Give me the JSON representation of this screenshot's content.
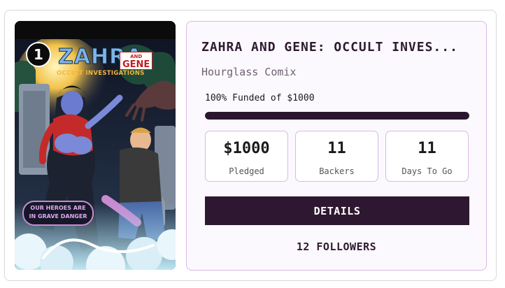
{
  "cover": {
    "issue_number": "1",
    "logo_title": "ZAHRA",
    "logo_and": "AND",
    "logo_gene": "GENE",
    "logo_subtitle": "OCCULT INVESTIGATIONS",
    "tagline_line1": "OUR HEROES ARE",
    "tagline_line2": "IN GRAVE DANGER"
  },
  "campaign": {
    "title": "ZAHRA AND GENE: OCCULT INVES...",
    "publisher": "Hourglass Comix",
    "funded_text": "100% Funded of $1000",
    "progress_fraction": 1.0
  },
  "stats": [
    {
      "value": "$1000",
      "label": "Pledged"
    },
    {
      "value": "11",
      "label": "Backers"
    },
    {
      "value": "11",
      "label": "Days To Go"
    }
  ],
  "details_label": "DETAILS",
  "followers_text": "12 FOLLOWERS",
  "colors": {
    "accent_dark": "#2e1730",
    "panel_border": "#d9b8e6",
    "panel_bg": "#fcf9fe"
  }
}
